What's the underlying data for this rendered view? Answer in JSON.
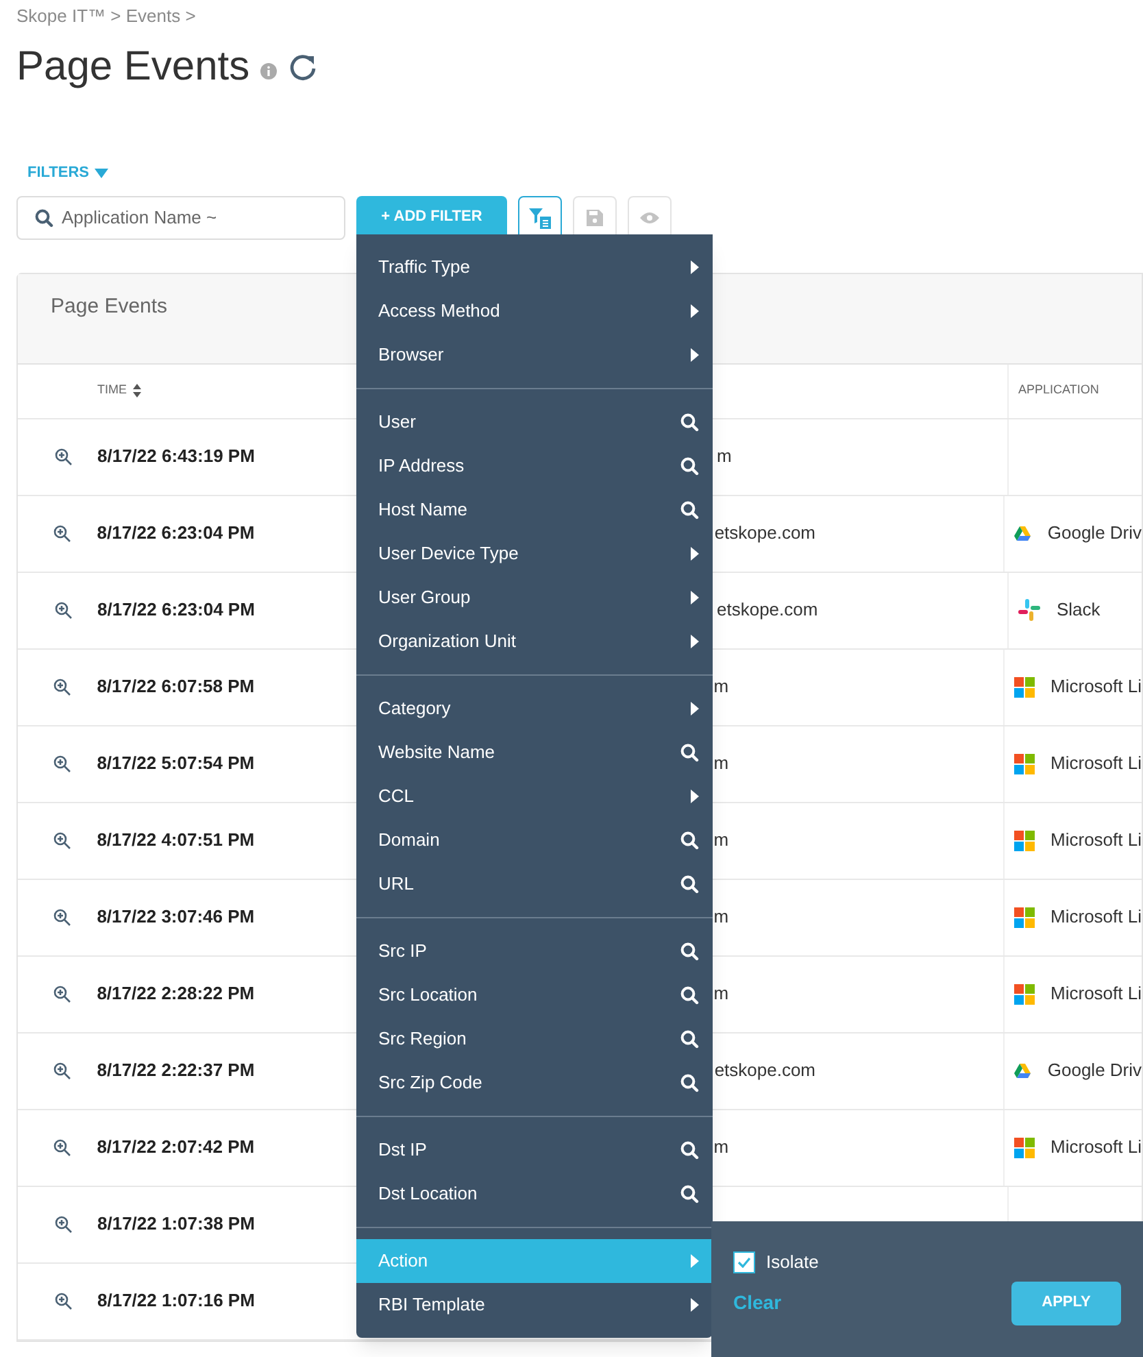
{
  "breadcrumb": "Skope IT™ > Events >",
  "title": "Page Events",
  "filters_label": "FILTERS",
  "search": {
    "placeholder": "Application Name ~"
  },
  "add_filter_button": "+ ADD FILTER",
  "toolbar_buttons": [
    {
      "kind": "filter-list",
      "disabled": false
    },
    {
      "kind": "save",
      "disabled": true
    },
    {
      "kind": "view",
      "disabled": true
    }
  ],
  "table": {
    "title": "Page Events",
    "columns": [
      "TIME",
      "APPLICATION"
    ],
    "rows": [
      {
        "time": "8/17/22 6:43:19 PM",
        "user": "m"
      },
      {
        "time": "8/17/22 6:23:04 PM",
        "user": "etskope.com",
        "application": {
          "kind": "drive",
          "name": "Google Driv"
        }
      },
      {
        "time": "8/17/22 6:23:04 PM",
        "user": "etskope.com",
        "application": {
          "kind": "slack",
          "name": "Slack"
        }
      },
      {
        "time": "8/17/22 6:07:58 PM",
        "user": "m",
        "application": {
          "kind": "windows",
          "name": "Microsoft Li"
        }
      },
      {
        "time": "8/17/22 5:07:54 PM",
        "user": "m",
        "application": {
          "kind": "windows",
          "name": "Microsoft Li"
        }
      },
      {
        "time": "8/17/22 4:07:51 PM",
        "user": "m",
        "application": {
          "kind": "windows",
          "name": "Microsoft Li"
        }
      },
      {
        "time": "8/17/22 3:07:46 PM",
        "user": "m",
        "application": {
          "kind": "windows",
          "name": "Microsoft Li"
        }
      },
      {
        "time": "8/17/22 2:28:22 PM",
        "user": "m",
        "application": {
          "kind": "windows",
          "name": "Microsoft Li"
        }
      },
      {
        "time": "8/17/22 2:22:37 PM",
        "user": "etskope.com",
        "application": {
          "kind": "drive",
          "name": "Google Driv"
        }
      },
      {
        "time": "8/17/22 2:07:42 PM",
        "user": "m",
        "application": {
          "kind": "windows",
          "name": "Microsoft Li"
        }
      },
      {
        "time": "8/17/22 1:07:38 PM"
      },
      {
        "time": "8/17/22 1:07:16 PM"
      }
    ]
  },
  "filter_menu": {
    "groups": [
      [
        {
          "label": "Traffic Type",
          "kind": "submenu",
          "selected": false
        },
        {
          "label": "Access Method",
          "kind": "submenu",
          "selected": false
        },
        {
          "label": "Browser",
          "kind": "submenu",
          "selected": false
        }
      ],
      [
        {
          "label": "User",
          "kind": "search",
          "selected": false
        },
        {
          "label": "IP Address",
          "kind": "search",
          "selected": false
        },
        {
          "label": "Host Name",
          "kind": "search",
          "selected": false
        },
        {
          "label": "User Device Type",
          "kind": "submenu",
          "selected": false
        },
        {
          "label": "User Group",
          "kind": "submenu",
          "selected": false
        },
        {
          "label": "Organization Unit",
          "kind": "submenu",
          "selected": false
        }
      ],
      [
        {
          "label": "Category",
          "kind": "submenu",
          "selected": false
        },
        {
          "label": "Website Name",
          "kind": "search",
          "selected": false
        },
        {
          "label": "CCL",
          "kind": "submenu",
          "selected": false
        },
        {
          "label": "Domain",
          "kind": "search",
          "selected": false
        },
        {
          "label": "URL",
          "kind": "search",
          "selected": false
        }
      ],
      [
        {
          "label": "Src IP",
          "kind": "search",
          "selected": false
        },
        {
          "label": "Src Location",
          "kind": "search",
          "selected": false
        },
        {
          "label": "Src Region",
          "kind": "search",
          "selected": false
        },
        {
          "label": "Src Zip Code",
          "kind": "search",
          "selected": false
        }
      ],
      [
        {
          "label": "Dst IP",
          "kind": "search",
          "selected": false
        },
        {
          "label": "Dst Location",
          "kind": "search",
          "selected": false
        }
      ],
      [
        {
          "label": "Action",
          "kind": "submenu",
          "selected": true
        },
        {
          "label": "RBI Template",
          "kind": "submenu",
          "selected": false
        }
      ]
    ]
  },
  "submenu": {
    "options": [
      {
        "label": "Isolate",
        "checked": true
      }
    ],
    "clear": "Clear",
    "apply": "APPLY"
  }
}
